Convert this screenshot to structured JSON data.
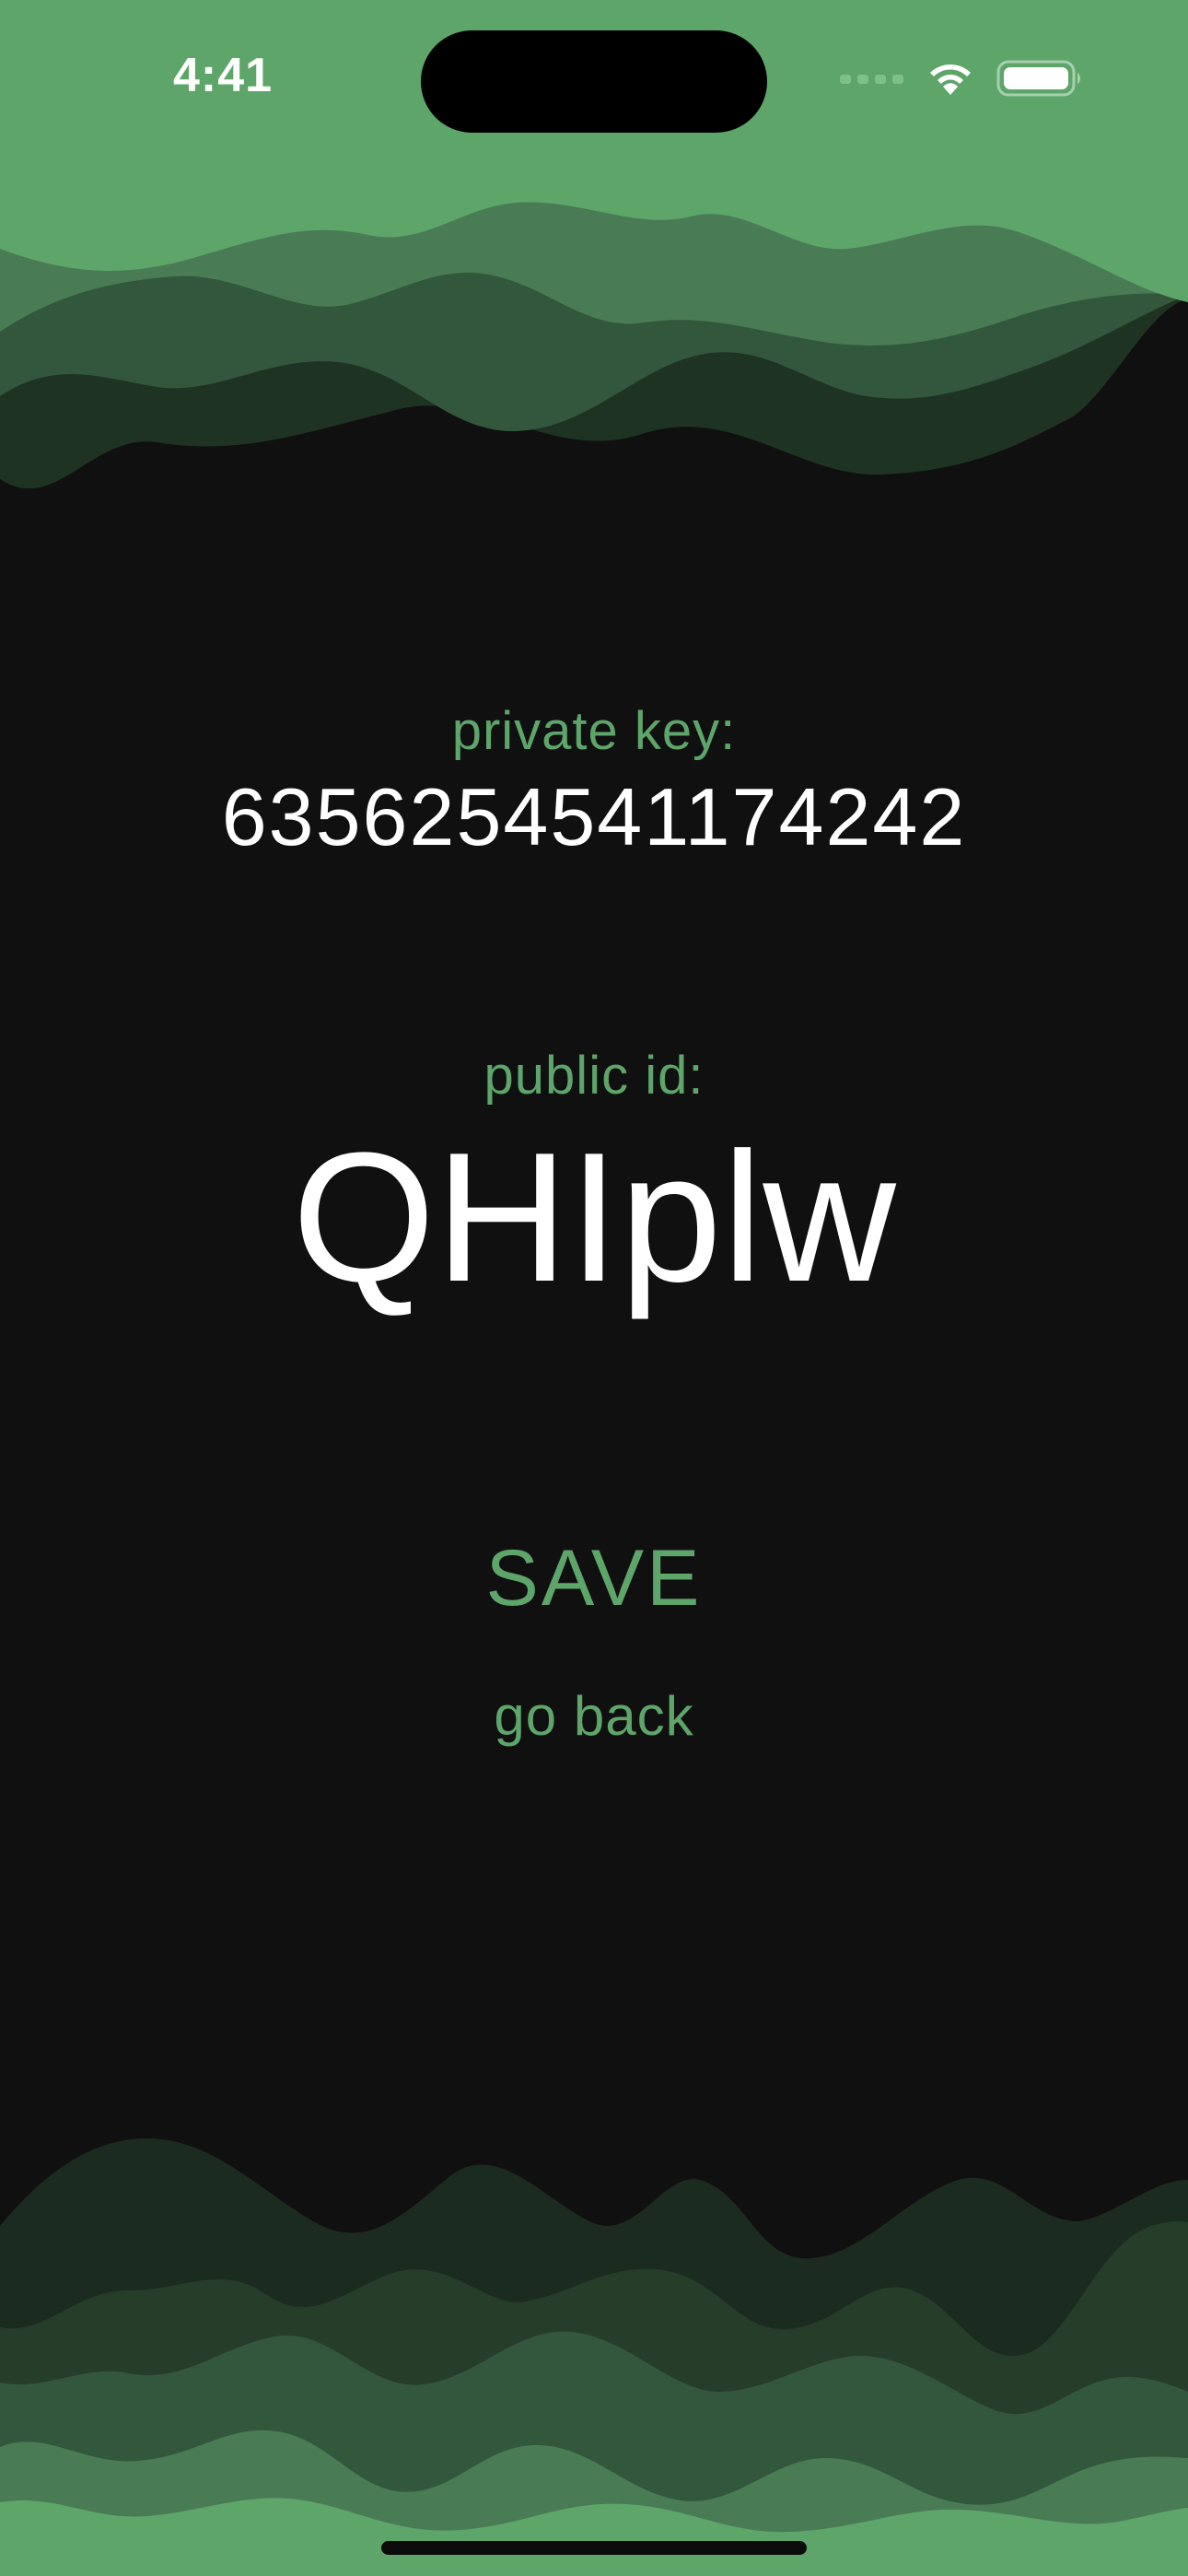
{
  "status_bar": {
    "time": "4:41",
    "icons": [
      "cellular-signal-icon",
      "wifi-icon",
      "battery-icon"
    ]
  },
  "private_key": {
    "label": "private key:",
    "value": "6356254541174242"
  },
  "public_id": {
    "label": "public id:",
    "value": "QHIplw"
  },
  "actions": {
    "save_label": "SAVE",
    "back_label": "go back"
  },
  "colors": {
    "background": "#101010",
    "accent": "#5ea56a",
    "text": "#ffffff",
    "wave_light": "#5ea56a",
    "wave_mid": "#497c55",
    "wave_dark": "#33573c",
    "wave_darker": "#1f3323"
  }
}
